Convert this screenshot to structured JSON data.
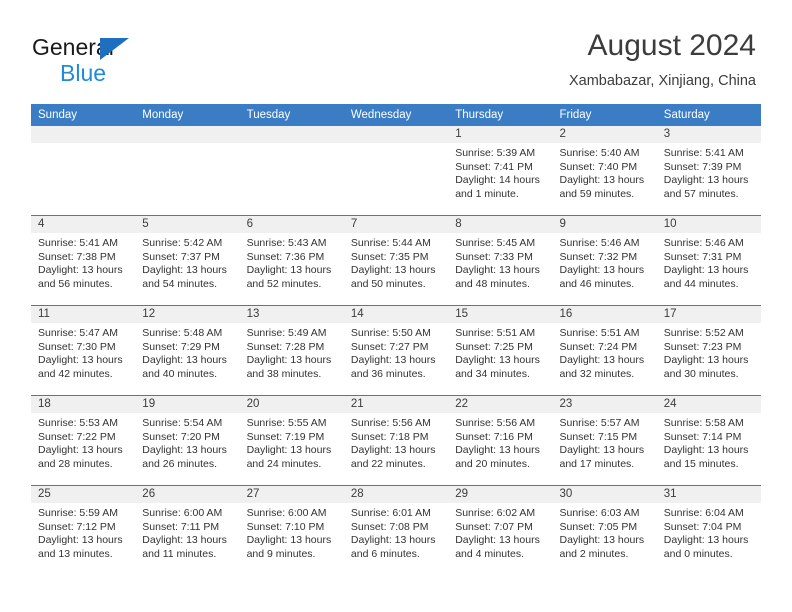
{
  "brand": {
    "line1": "General",
    "line2": "Blue",
    "triangle_color": "#1f6fc0",
    "blue_color": "#1f8bdb"
  },
  "header": {
    "title": "August 2024",
    "subtitle": "Xambabazar, Xinjiang, China",
    "accent_color": "#3b7dc4",
    "daynum_band_color": "#f0f0f0"
  },
  "weekdays": [
    "Sunday",
    "Monday",
    "Tuesday",
    "Wednesday",
    "Thursday",
    "Friday",
    "Saturday"
  ],
  "weeks": [
    [
      {
        "day": "",
        "sunrise": "",
        "sunset": "",
        "daylight": "",
        "daylight2": ""
      },
      {
        "day": "",
        "sunrise": "",
        "sunset": "",
        "daylight": "",
        "daylight2": ""
      },
      {
        "day": "",
        "sunrise": "",
        "sunset": "",
        "daylight": "",
        "daylight2": ""
      },
      {
        "day": "",
        "sunrise": "",
        "sunset": "",
        "daylight": "",
        "daylight2": ""
      },
      {
        "day": "1",
        "sunrise": "Sunrise: 5:39 AM",
        "sunset": "Sunset: 7:41 PM",
        "daylight": "Daylight: 14 hours",
        "daylight2": "and 1 minute."
      },
      {
        "day": "2",
        "sunrise": "Sunrise: 5:40 AM",
        "sunset": "Sunset: 7:40 PM",
        "daylight": "Daylight: 13 hours",
        "daylight2": "and 59 minutes."
      },
      {
        "day": "3",
        "sunrise": "Sunrise: 5:41 AM",
        "sunset": "Sunset: 7:39 PM",
        "daylight": "Daylight: 13 hours",
        "daylight2": "and 57 minutes."
      }
    ],
    [
      {
        "day": "4",
        "sunrise": "Sunrise: 5:41 AM",
        "sunset": "Sunset: 7:38 PM",
        "daylight": "Daylight: 13 hours",
        "daylight2": "and 56 minutes."
      },
      {
        "day": "5",
        "sunrise": "Sunrise: 5:42 AM",
        "sunset": "Sunset: 7:37 PM",
        "daylight": "Daylight: 13 hours",
        "daylight2": "and 54 minutes."
      },
      {
        "day": "6",
        "sunrise": "Sunrise: 5:43 AM",
        "sunset": "Sunset: 7:36 PM",
        "daylight": "Daylight: 13 hours",
        "daylight2": "and 52 minutes."
      },
      {
        "day": "7",
        "sunrise": "Sunrise: 5:44 AM",
        "sunset": "Sunset: 7:35 PM",
        "daylight": "Daylight: 13 hours",
        "daylight2": "and 50 minutes."
      },
      {
        "day": "8",
        "sunrise": "Sunrise: 5:45 AM",
        "sunset": "Sunset: 7:33 PM",
        "daylight": "Daylight: 13 hours",
        "daylight2": "and 48 minutes."
      },
      {
        "day": "9",
        "sunrise": "Sunrise: 5:46 AM",
        "sunset": "Sunset: 7:32 PM",
        "daylight": "Daylight: 13 hours",
        "daylight2": "and 46 minutes."
      },
      {
        "day": "10",
        "sunrise": "Sunrise: 5:46 AM",
        "sunset": "Sunset: 7:31 PM",
        "daylight": "Daylight: 13 hours",
        "daylight2": "and 44 minutes."
      }
    ],
    [
      {
        "day": "11",
        "sunrise": "Sunrise: 5:47 AM",
        "sunset": "Sunset: 7:30 PM",
        "daylight": "Daylight: 13 hours",
        "daylight2": "and 42 minutes."
      },
      {
        "day": "12",
        "sunrise": "Sunrise: 5:48 AM",
        "sunset": "Sunset: 7:29 PM",
        "daylight": "Daylight: 13 hours",
        "daylight2": "and 40 minutes."
      },
      {
        "day": "13",
        "sunrise": "Sunrise: 5:49 AM",
        "sunset": "Sunset: 7:28 PM",
        "daylight": "Daylight: 13 hours",
        "daylight2": "and 38 minutes."
      },
      {
        "day": "14",
        "sunrise": "Sunrise: 5:50 AM",
        "sunset": "Sunset: 7:27 PM",
        "daylight": "Daylight: 13 hours",
        "daylight2": "and 36 minutes."
      },
      {
        "day": "15",
        "sunrise": "Sunrise: 5:51 AM",
        "sunset": "Sunset: 7:25 PM",
        "daylight": "Daylight: 13 hours",
        "daylight2": "and 34 minutes."
      },
      {
        "day": "16",
        "sunrise": "Sunrise: 5:51 AM",
        "sunset": "Sunset: 7:24 PM",
        "daylight": "Daylight: 13 hours",
        "daylight2": "and 32 minutes."
      },
      {
        "day": "17",
        "sunrise": "Sunrise: 5:52 AM",
        "sunset": "Sunset: 7:23 PM",
        "daylight": "Daylight: 13 hours",
        "daylight2": "and 30 minutes."
      }
    ],
    [
      {
        "day": "18",
        "sunrise": "Sunrise: 5:53 AM",
        "sunset": "Sunset: 7:22 PM",
        "daylight": "Daylight: 13 hours",
        "daylight2": "and 28 minutes."
      },
      {
        "day": "19",
        "sunrise": "Sunrise: 5:54 AM",
        "sunset": "Sunset: 7:20 PM",
        "daylight": "Daylight: 13 hours",
        "daylight2": "and 26 minutes."
      },
      {
        "day": "20",
        "sunrise": "Sunrise: 5:55 AM",
        "sunset": "Sunset: 7:19 PM",
        "daylight": "Daylight: 13 hours",
        "daylight2": "and 24 minutes."
      },
      {
        "day": "21",
        "sunrise": "Sunrise: 5:56 AM",
        "sunset": "Sunset: 7:18 PM",
        "daylight": "Daylight: 13 hours",
        "daylight2": "and 22 minutes."
      },
      {
        "day": "22",
        "sunrise": "Sunrise: 5:56 AM",
        "sunset": "Sunset: 7:16 PM",
        "daylight": "Daylight: 13 hours",
        "daylight2": "and 20 minutes."
      },
      {
        "day": "23",
        "sunrise": "Sunrise: 5:57 AM",
        "sunset": "Sunset: 7:15 PM",
        "daylight": "Daylight: 13 hours",
        "daylight2": "and 17 minutes."
      },
      {
        "day": "24",
        "sunrise": "Sunrise: 5:58 AM",
        "sunset": "Sunset: 7:14 PM",
        "daylight": "Daylight: 13 hours",
        "daylight2": "and 15 minutes."
      }
    ],
    [
      {
        "day": "25",
        "sunrise": "Sunrise: 5:59 AM",
        "sunset": "Sunset: 7:12 PM",
        "daylight": "Daylight: 13 hours",
        "daylight2": "and 13 minutes."
      },
      {
        "day": "26",
        "sunrise": "Sunrise: 6:00 AM",
        "sunset": "Sunset: 7:11 PM",
        "daylight": "Daylight: 13 hours",
        "daylight2": "and 11 minutes."
      },
      {
        "day": "27",
        "sunrise": "Sunrise: 6:00 AM",
        "sunset": "Sunset: 7:10 PM",
        "daylight": "Daylight: 13 hours",
        "daylight2": "and 9 minutes."
      },
      {
        "day": "28",
        "sunrise": "Sunrise: 6:01 AM",
        "sunset": "Sunset: 7:08 PM",
        "daylight": "Daylight: 13 hours",
        "daylight2": "and 6 minutes."
      },
      {
        "day": "29",
        "sunrise": "Sunrise: 6:02 AM",
        "sunset": "Sunset: 7:07 PM",
        "daylight": "Daylight: 13 hours",
        "daylight2": "and 4 minutes."
      },
      {
        "day": "30",
        "sunrise": "Sunrise: 6:03 AM",
        "sunset": "Sunset: 7:05 PM",
        "daylight": "Daylight: 13 hours",
        "daylight2": "and 2 minutes."
      },
      {
        "day": "31",
        "sunrise": "Sunrise: 6:04 AM",
        "sunset": "Sunset: 7:04 PM",
        "daylight": "Daylight: 13 hours",
        "daylight2": "and 0 minutes."
      }
    ]
  ]
}
